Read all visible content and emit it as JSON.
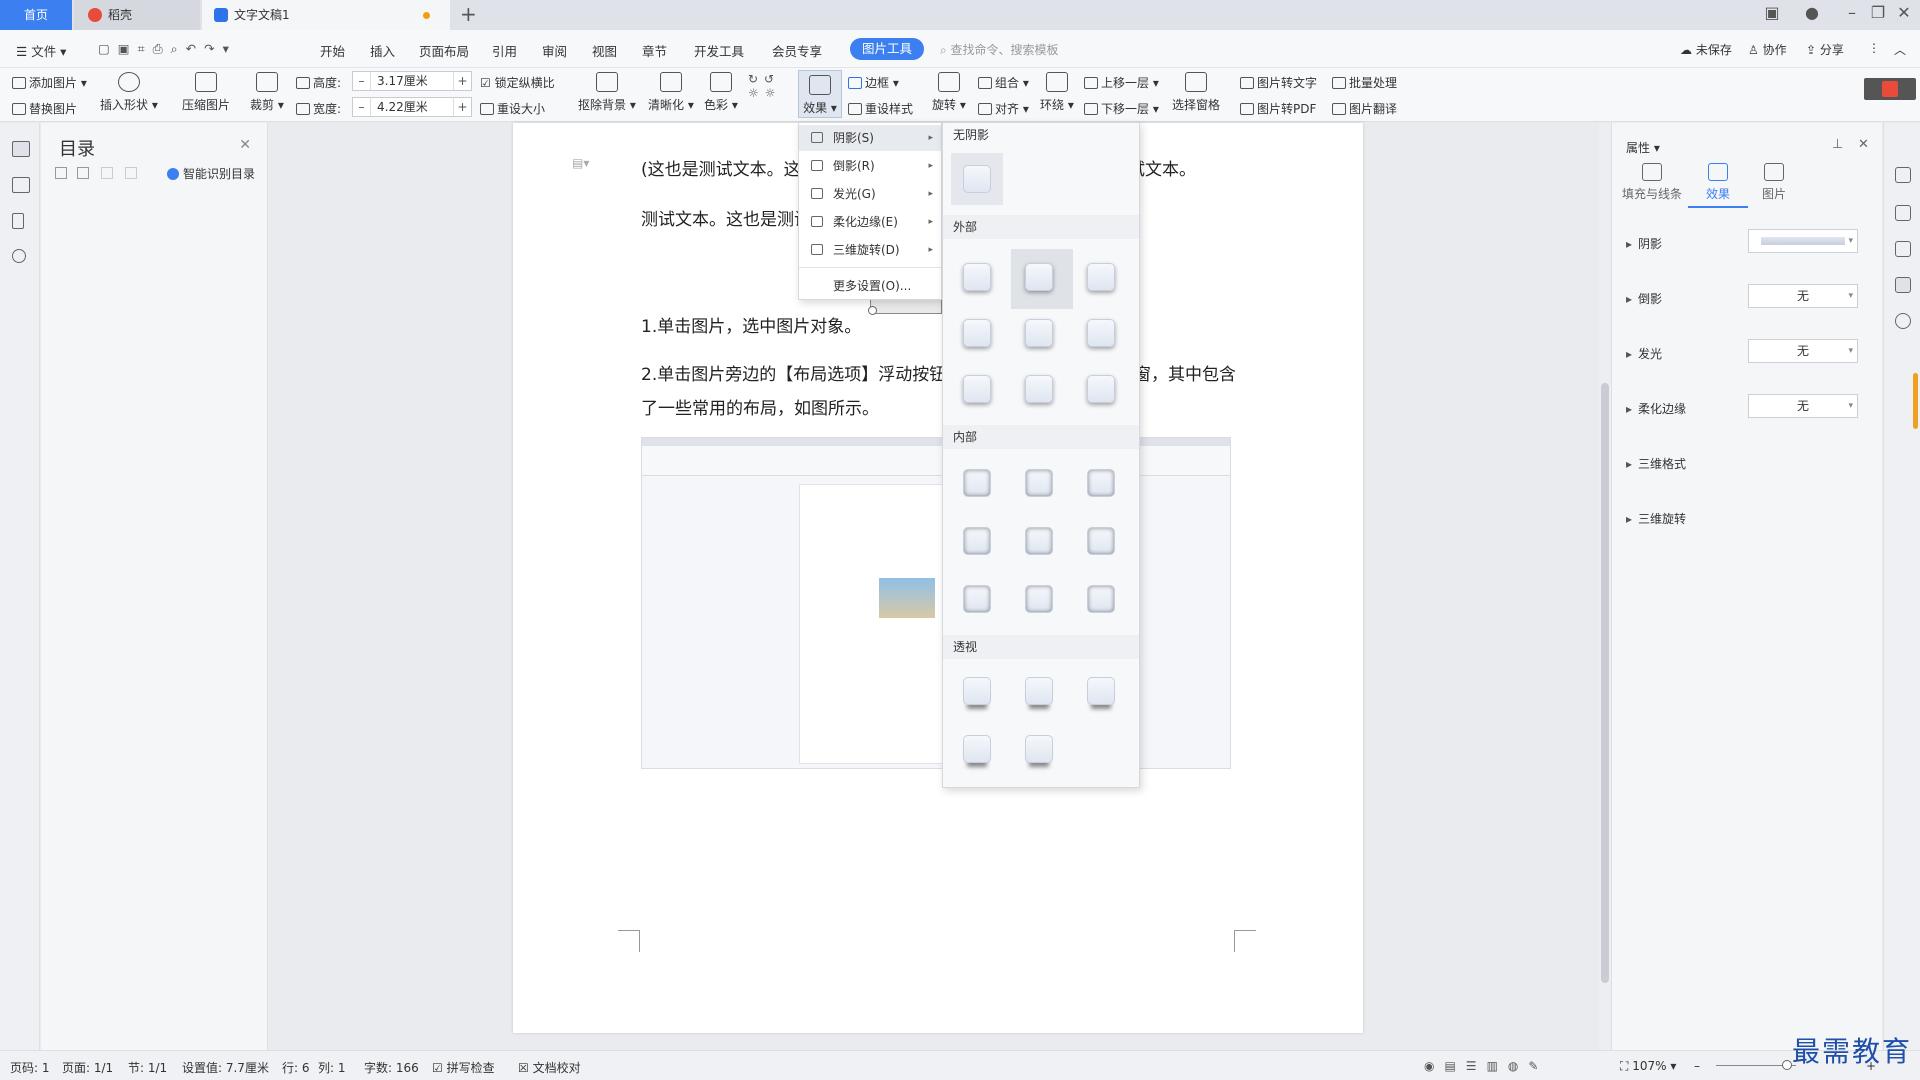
{
  "tabs": {
    "home": "首页",
    "daoke": "稻壳",
    "doc": "文字文稿1"
  },
  "menu": {
    "file": "文件",
    "items": [
      "开始",
      "插入",
      "页面布局",
      "引用",
      "审阅",
      "视图",
      "章节",
      "开发工具",
      "会员专享"
    ],
    "pic_tools": "图片工具",
    "search": "查找命令、搜索模板",
    "unsaved": "未保存",
    "collab": "协作",
    "share": "分享"
  },
  "ribbon": {
    "add_pic": "添加图片",
    "replace_pic": "替换图片",
    "insert_shape": "插入形状",
    "compress": "压缩图片",
    "crop": "裁剪",
    "height_label": "高度:",
    "height_val": "3.17厘米",
    "width_label": "宽度:",
    "width_val": "4.22厘米",
    "lock_ratio": "锁定纵横比",
    "reset_size": "重设大小",
    "remove_bg": "抠除背景",
    "sharpen": "清晰化",
    "color": "色彩",
    "effects": "效果",
    "border": "边框",
    "reset_style": "重设样式",
    "rotate": "旋转",
    "group": "组合",
    "align": "对齐",
    "wrap": "环绕",
    "bring_forward": "上移一层",
    "send_backward": "下移一层",
    "select_pane": "选择窗格",
    "pic_to_text": "图片转文字",
    "pic_to_pdf": "图片转PDF",
    "batch": "批量处理",
    "translate": "图片翻译"
  },
  "toc": {
    "title": "目录",
    "smart": "智能识别目录"
  },
  "doc": {
    "p1": "(这也是测试文本。这",
    "p1b": "试文本。",
    "p2": "测试文本。这也是测试",
    "p3": "1.单击图片，选中图片对象。",
    "p4a": "2.单击图片旁边的【布局选项】浮动按钮",
    "p4b": "窗，其中包含",
    "p5": "了一些常用的布局，如图所示。"
  },
  "dropdown": {
    "items": [
      {
        "label": "阴影(S)",
        "arrow": "▸"
      },
      {
        "label": "倒影(R)",
        "arrow": "▸"
      },
      {
        "label": "发光(G)",
        "arrow": "▸"
      },
      {
        "label": "柔化边缘(E)",
        "arrow": "▸"
      },
      {
        "label": "三维旋转(D)",
        "arrow": "▸"
      }
    ],
    "more": "更多设置(O)..."
  },
  "shadow_panel": {
    "none": "无阴影",
    "outer": "外部",
    "inner": "内部",
    "perspective": "透视"
  },
  "rpanel": {
    "title": "属性",
    "tabs": [
      "填充与线条",
      "效果",
      "图片"
    ],
    "rows": [
      {
        "label": "阴影",
        "value": ""
      },
      {
        "label": "倒影",
        "value": "无"
      },
      {
        "label": "发光",
        "value": "无"
      },
      {
        "label": "柔化边缘",
        "value": "无"
      },
      {
        "label": "三维格式",
        "value": ""
      },
      {
        "label": "三维旋转",
        "value": ""
      }
    ]
  },
  "status": {
    "page": "页码: 1",
    "pages": "页面: 1/1",
    "section": "节: 1/1",
    "setting": "设置值: 7.7厘米",
    "row": "行: 6",
    "col": "列: 1",
    "words": "字数: 166",
    "spell": "拼写检查",
    "proof": "文档校对",
    "zoom": "107%"
  },
  "watermark": "最需教育"
}
